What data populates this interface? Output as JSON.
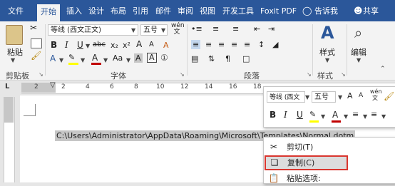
{
  "ribbon_tabs": [
    "文件",
    "开始",
    "插入",
    "设计",
    "布局",
    "引用",
    "邮件",
    "审阅",
    "视图",
    "开发工具",
    "Foxit PDF"
  ],
  "tell_me": "告诉我",
  "share": "共享",
  "clipboard": {
    "paste_label": "粘贴",
    "group_label": "剪贴板"
  },
  "font": {
    "name": "等线 (西文正文)",
    "size": "五号",
    "group_label": "字体",
    "wen_icon": "wén",
    "bold": "B",
    "italic": "I",
    "underline": "U",
    "strike": "abc",
    "subscript": "x₂",
    "superscript": "x²",
    "font_color_letter": "A",
    "grow": "A",
    "shrink": "A",
    "clear_format": "A",
    "case": "Aa",
    "char_border": "A"
  },
  "paragraph": {
    "group_label": "段落"
  },
  "styles": {
    "label": "样式",
    "group_label": "样式"
  },
  "editing": {
    "label": "编辑"
  },
  "ruler_ticks": [
    "2",
    "2",
    "4",
    "6",
    "8",
    "10",
    "12",
    "14",
    "16",
    "18"
  ],
  "tab_stop_letter": "L",
  "document": {
    "selected_text": "C:\\Users\\Administrator\\AppData\\Roaming\\Microsoft\\Templates\\Normal.dotm"
  },
  "mini_toolbar": {
    "font": "等线 (西文",
    "size": "五号",
    "wen": "wén",
    "bold": "B",
    "italic": "I",
    "underline": "U"
  },
  "context_menu": {
    "cut": "剪切(T)",
    "copy": "复制(C)",
    "paste_options": "粘贴选项:"
  },
  "colors": {
    "accent": "#2b579a",
    "highlight": "#ffff00",
    "font_color": "#c00000",
    "copy_outline": "#d9362e"
  }
}
